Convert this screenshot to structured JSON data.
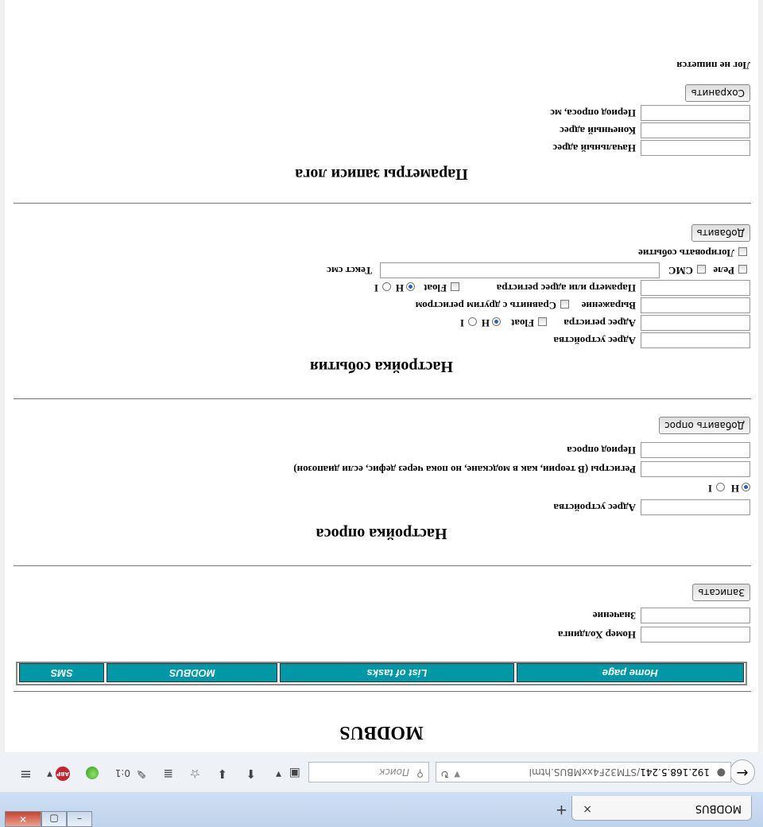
{
  "browser": {
    "tab_title": "MODBUS",
    "tab_close": "×",
    "new_tab": "+",
    "url_host": "192.168.5.241",
    "url_path": "/STM32F4xxMBUS.html",
    "search_placeholder": "Поиск",
    "timer": "0:1"
  },
  "page": {
    "title": "MODBUS",
    "nav": [
      "Home page",
      "List of tasks",
      "MODBUS",
      "SMS"
    ],
    "write": {
      "holding_label": "Номер Холдинга",
      "value_label": "Значение",
      "button": "Записать"
    },
    "poll": {
      "title": "Настройка опроса",
      "device_label": "Адрес устройства",
      "radio_h": "H",
      "radio_i": "I",
      "registers_label": "Регистры (В теории, как в модскане, но пока через дефис, если диапозон)",
      "period_label": "Период опроса",
      "button": "Добавить опрос"
    },
    "event": {
      "title": "Настройка события",
      "device_label": "Адрес устройства",
      "register_label": "Адрес регистра",
      "float_label": "Float",
      "radio_h": "H",
      "radio_i": "I",
      "expression_label": "Выражение",
      "compare_label": "Сравнить с другим регистром",
      "param_label": "Параметр или адрес регистра",
      "relay_label": "Реле",
      "sms_label": "СМС",
      "sms_text_label": "Текст смс",
      "log_event_label": "Логировать событие",
      "button": "Добавить"
    },
    "log": {
      "title": "Параметры записи лога",
      "start_label": "Начальный адрес",
      "end_label": "Конечный адрес",
      "period_label": "Период опроса, мс",
      "button": "Сохранить",
      "status": "Лог не пишется"
    }
  }
}
